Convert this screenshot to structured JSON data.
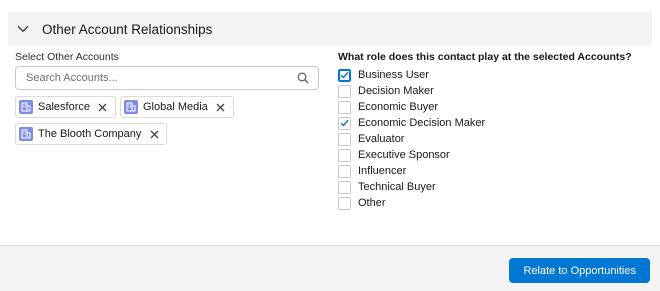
{
  "section": {
    "title": "Other Account Relationships",
    "chevron_icon": "chevron-down-icon"
  },
  "accounts": {
    "label": "Select Other Accounts",
    "search_placeholder": "Search Accounts...",
    "search_value": "",
    "selected": [
      {
        "name": "Salesforce",
        "icon": "account-icon"
      },
      {
        "name": "Global Media",
        "icon": "account-icon"
      },
      {
        "name": "The Blooth Company",
        "icon": "account-icon"
      }
    ]
  },
  "roles": {
    "question": "What role does this contact play at the selected Accounts?",
    "items": [
      {
        "label": "Business User",
        "checked": true,
        "focused": true
      },
      {
        "label": "Decision Maker",
        "checked": false
      },
      {
        "label": "Economic Buyer",
        "checked": false
      },
      {
        "label": "Economic Decision Maker",
        "checked": true
      },
      {
        "label": "Evaluator",
        "checked": false
      },
      {
        "label": "Executive Sponsor",
        "checked": false
      },
      {
        "label": "Influencer",
        "checked": false
      },
      {
        "label": "Technical Buyer",
        "checked": false
      },
      {
        "label": "Other",
        "checked": false
      }
    ]
  },
  "footer": {
    "primary_button": "Relate to Opportunities"
  },
  "colors": {
    "brand": "#0176d3",
    "account_icon": "#7f8de1",
    "header_bg": "#f3f3f3"
  }
}
